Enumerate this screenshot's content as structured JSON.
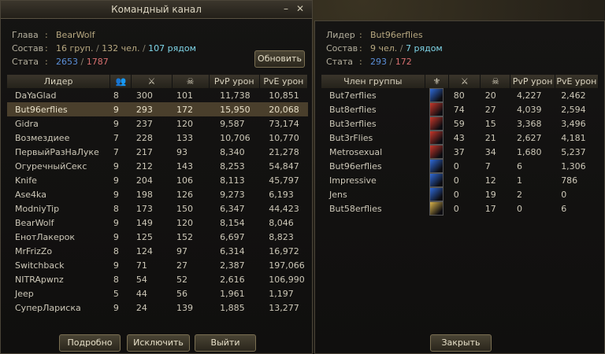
{
  "left": {
    "title": "Командный канал",
    "info": {
      "leader_label": "Глава",
      "leader_value": "BearWolf",
      "comp_label": "Состав",
      "groups": "16 груп.",
      "people": "132 чел.",
      "nearby": "107 рядом",
      "stat_label": "Стата",
      "stat_a": "2653",
      "stat_b": "1787"
    },
    "refresh_label": "Обновить",
    "headers": [
      "Лидер",
      "",
      "",
      "",
      "PvP урон",
      "PvE урон"
    ],
    "header_icons": [
      "people-icon",
      "crossed-swords-icon",
      "skull-icon"
    ],
    "rows": [
      [
        "DaYaGlad",
        "8",
        "300",
        "101",
        "11,738",
        "10,851"
      ],
      [
        "But96erflies",
        "9",
        "293",
        "172",
        "15,950",
        "20,068"
      ],
      [
        "Gidra",
        "9",
        "237",
        "120",
        "9,587",
        "73,174"
      ],
      [
        "Возмездиее",
        "7",
        "228",
        "133",
        "10,706",
        "10,770"
      ],
      [
        "ПервыйРазНаЛуке",
        "7",
        "217",
        "93",
        "8,340",
        "21,278"
      ],
      [
        "ОгуречныйСекс",
        "9",
        "212",
        "143",
        "8,253",
        "54,847"
      ],
      [
        "Knife",
        "9",
        "204",
        "106",
        "8,113",
        "45,797"
      ],
      [
        "Ase4ka",
        "9",
        "198",
        "126",
        "9,273",
        "6,193"
      ],
      [
        "ModniyTip",
        "8",
        "173",
        "150",
        "6,347",
        "44,423"
      ],
      [
        "BearWolf",
        "9",
        "149",
        "120",
        "8,154",
        "8,046"
      ],
      [
        "ЕнотЛакерок",
        "9",
        "125",
        "152",
        "6,697",
        "8,823"
      ],
      [
        "MrFrizZo",
        "8",
        "124",
        "97",
        "6,314",
        "16,972"
      ],
      [
        "Switchback",
        "9",
        "71",
        "27",
        "2,387",
        "197,066"
      ],
      [
        "NITRApwnz",
        "8",
        "54",
        "52",
        "2,616",
        "106,990"
      ],
      [
        "Jeep",
        "5",
        "44",
        "56",
        "1,961",
        "1,197"
      ],
      [
        "СуперЛариска",
        "9",
        "24",
        "139",
        "1,885",
        "13,277"
      ]
    ],
    "selected_row": 1,
    "buttons": {
      "details": "Подробно",
      "exclude": "Исключить",
      "leave": "Выйти"
    }
  },
  "right": {
    "info": {
      "leader_label": "Лидер",
      "leader_value": "But96erflies",
      "comp_label": "Состав",
      "people": "9 чел.",
      "nearby": "7 рядом",
      "stat_label": "Стата",
      "stat_a": "293",
      "stat_b": "172"
    },
    "headers": [
      "Член группы",
      "",
      "",
      "",
      "PvP урон",
      "PvE урон"
    ],
    "header_icons": [
      "class-icon",
      "crossed-swords-icon",
      "skull-icon"
    ],
    "rows": [
      [
        "But7erflies",
        "80",
        "20",
        "4,227",
        "2,462"
      ],
      [
        "But8erflies",
        "74",
        "27",
        "4,039",
        "2,594"
      ],
      [
        "But3erflies",
        "59",
        "15",
        "3,368",
        "3,496"
      ],
      [
        "But3rFlies",
        "43",
        "21",
        "2,627",
        "4,181"
      ],
      [
        "Metrosexual",
        "37",
        "34",
        "1,680",
        "5,237"
      ],
      [
        "But96erflies",
        "0",
        "7",
        "6",
        "1,306"
      ],
      [
        "Impressive",
        "0",
        "12",
        "1",
        "786"
      ],
      [
        "Jens",
        "0",
        "19",
        "2",
        "0"
      ],
      [
        "But58erflies",
        "0",
        "17",
        "0",
        "6"
      ]
    ],
    "class_icons": [
      "blue",
      "red",
      "red",
      "red",
      "red",
      "blue",
      "blue",
      "blue",
      "gold"
    ],
    "close_label": "Закрыть"
  },
  "colors": {
    "accent_blue": "#5b8fd8",
    "accent_red": "#d87070",
    "accent_cyan": "#7fd6e8"
  }
}
